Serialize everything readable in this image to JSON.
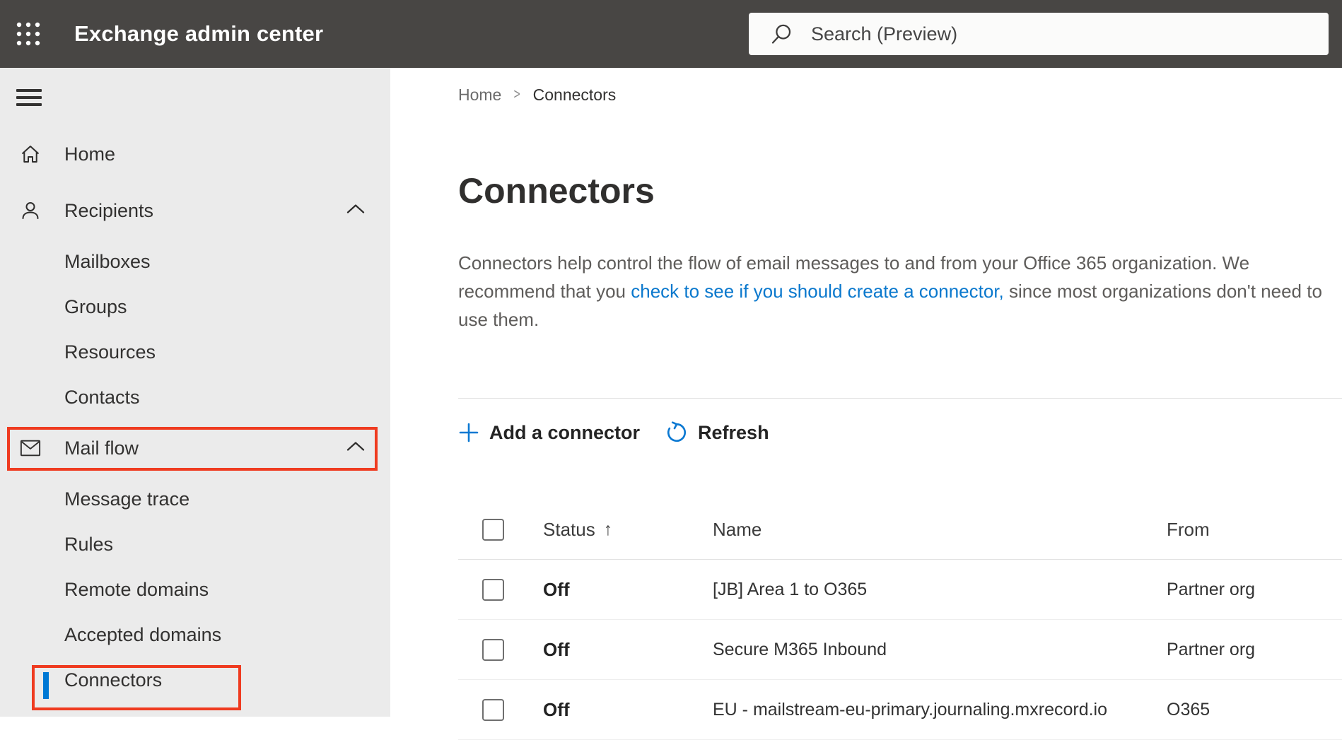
{
  "topbar": {
    "app_title": "Exchange admin center",
    "search_placeholder": "Search (Preview)"
  },
  "sidebar": {
    "items": [
      {
        "label": "Home",
        "icon": "home"
      },
      {
        "label": "Recipients",
        "icon": "person",
        "expanded": true
      },
      {
        "label": "Mailboxes"
      },
      {
        "label": "Groups"
      },
      {
        "label": "Resources"
      },
      {
        "label": "Contacts"
      },
      {
        "label": "Mail flow",
        "icon": "mail",
        "expanded": true,
        "annotated": true
      },
      {
        "label": "Message trace"
      },
      {
        "label": "Rules"
      },
      {
        "label": "Remote domains"
      },
      {
        "label": "Accepted domains"
      },
      {
        "label": "Connectors",
        "selected": true,
        "annotated": true
      }
    ]
  },
  "breadcrumb": {
    "home": "Home",
    "separator": ">",
    "current": "Connectors"
  },
  "page": {
    "title": "Connectors",
    "desc_before": "Connectors help control the flow of email messages to and from your Office 365 organization. We recommend that you ",
    "desc_link": "check to see if you should create a connector,",
    "desc_after": " since most organizations don't need to use them."
  },
  "toolbar": {
    "add_label": "Add a connector",
    "refresh_label": "Refresh"
  },
  "table": {
    "headers": {
      "status": "Status",
      "name": "Name",
      "from": "From"
    },
    "sort_icon": "↑",
    "rows": [
      {
        "status": "Off",
        "name": "[JB] Area 1 to O365",
        "from": "Partner org"
      },
      {
        "status": "Off",
        "name": "Secure M365 Inbound",
        "from": "Partner org"
      },
      {
        "status": "Off",
        "name": "EU - mailstream-eu-primary.journaling.mxrecord.io",
        "from": "O365"
      }
    ]
  },
  "colors": {
    "topbar_bg": "#484644",
    "sidebar_bg": "#ebebeb",
    "accent_blue": "#0078d4",
    "link_blue": "#0a78cd",
    "annotation_red": "#ef3b20"
  }
}
